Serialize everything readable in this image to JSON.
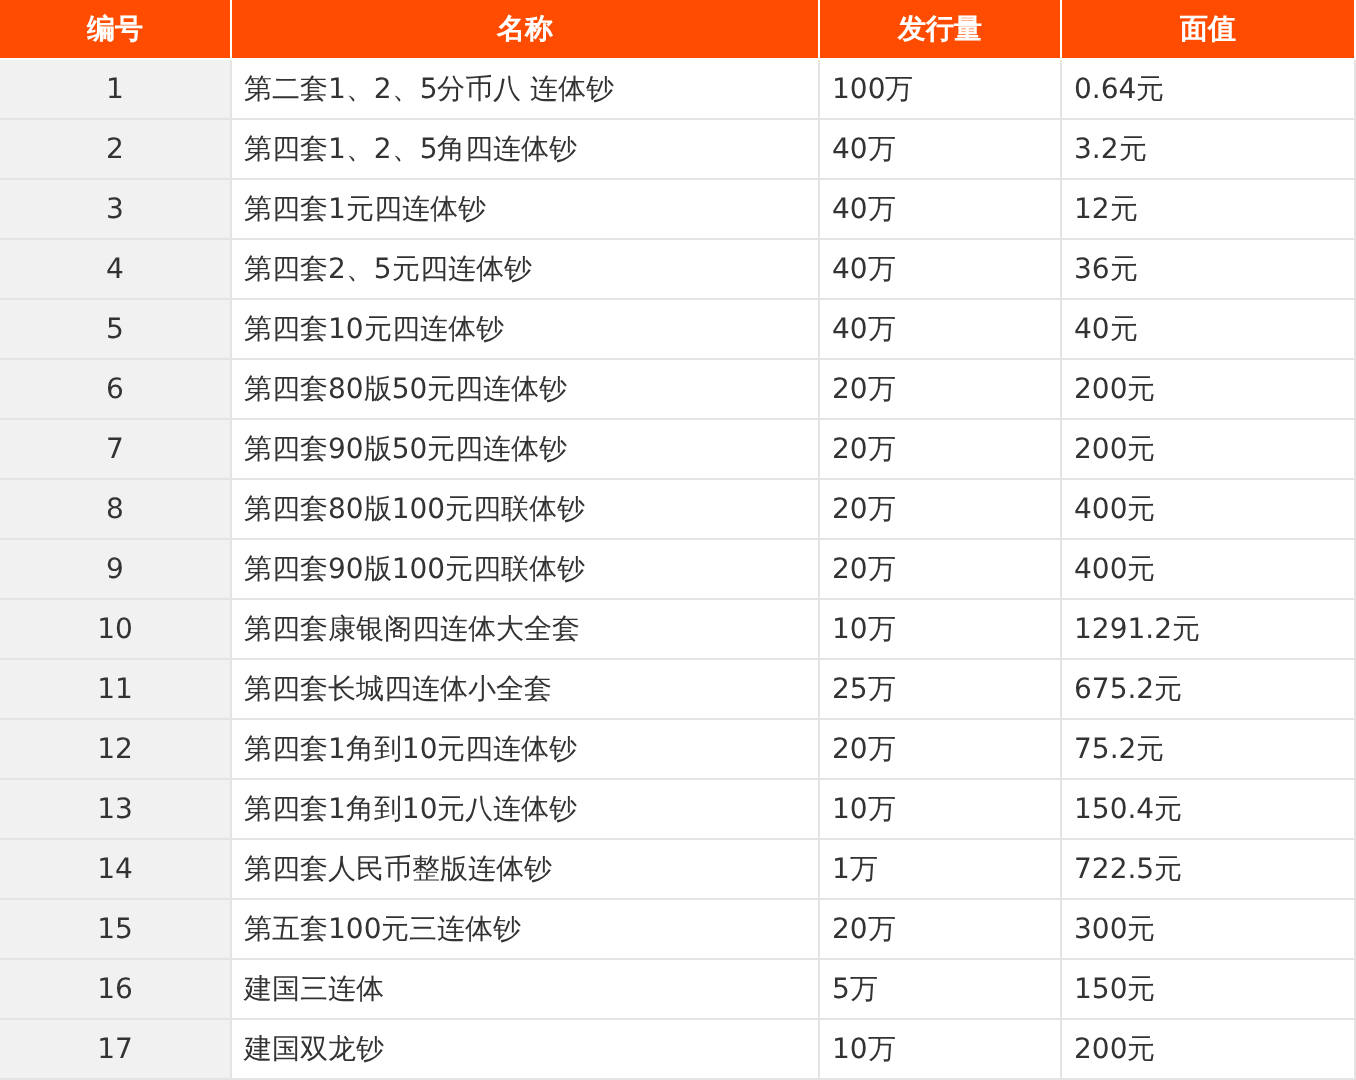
{
  "table": {
    "columns": [
      "编号",
      "名称",
      "发行量",
      "面值"
    ],
    "rows": [
      [
        "1",
        "第二套1、2、5分币八 连体钞",
        "100万",
        "0.64元"
      ],
      [
        "2",
        "第四套1、2、5角四连体钞",
        "40万",
        "3.2元"
      ],
      [
        "3",
        "第四套1元四连体钞",
        "40万",
        "12元"
      ],
      [
        "4",
        "第四套2、5元四连体钞",
        "40万",
        "36元"
      ],
      [
        "5",
        "第四套10元四连体钞",
        "40万",
        "40元"
      ],
      [
        "6",
        "第四套80版50元四连体钞",
        "20万",
        "200元"
      ],
      [
        "7",
        "第四套90版50元四连体钞",
        "20万",
        "200元"
      ],
      [
        "8",
        "第四套80版100元四联体钞",
        "20万",
        "400元"
      ],
      [
        "9",
        "第四套90版100元四联体钞",
        "20万",
        "400元"
      ],
      [
        "10",
        "第四套康银阁四连体大全套",
        "10万",
        "1291.2元"
      ],
      [
        "11",
        "第四套长城四连体小全套",
        "25万",
        "675.2元"
      ],
      [
        "12",
        "第四套1角到10元四连体钞",
        "20万",
        "75.2元"
      ],
      [
        "13",
        "第四套1角到10元八连体钞",
        "10万",
        "150.4元"
      ],
      [
        "14",
        "第四套人民币整版连体钞",
        "1万",
        "722.5元"
      ],
      [
        "15",
        "第五套100元三连体钞",
        "20万",
        "300元"
      ],
      [
        "16",
        "建国三连体",
        "5万",
        "150元"
      ],
      [
        "17",
        "建国双龙钞",
        "10万",
        "200元"
      ]
    ]
  }
}
